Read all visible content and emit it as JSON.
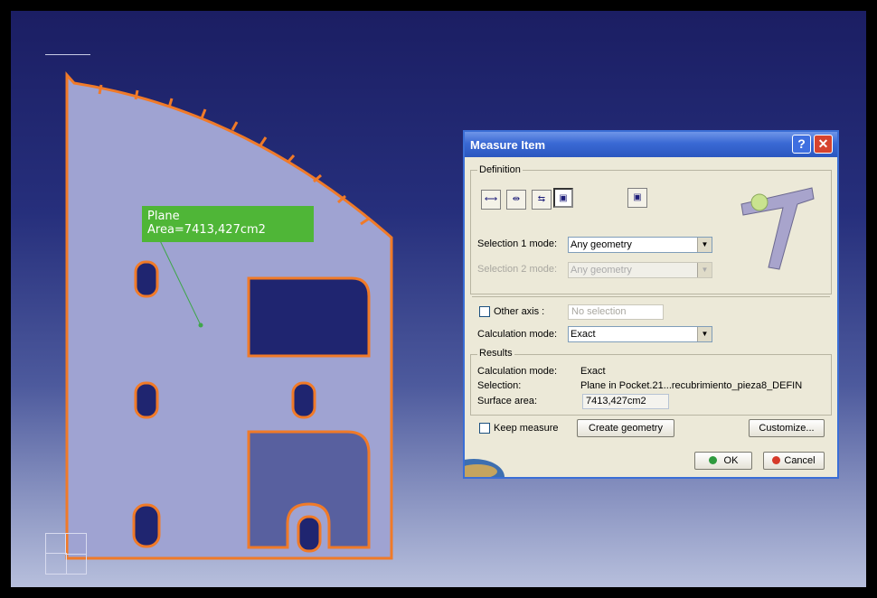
{
  "viewport": {
    "annotation": {
      "line1": "Plane",
      "line2": "Area=7413,427cm2"
    }
  },
  "dialog": {
    "title": "Measure Item",
    "title_buttons": {
      "help": "?",
      "close": "✕"
    },
    "definition": {
      "label": "Definition",
      "tools": [
        "measure-between",
        "measure-between-chain",
        "measure-between-fan",
        "measure-item-active",
        "measure-thickness"
      ],
      "selection1_label": "Selection 1 mode:",
      "selection1_value": "Any geometry",
      "selection2_label": "Selection 2 mode:",
      "selection2_value": "Any geometry",
      "other_axis_label": "Other axis :",
      "other_axis_placeholder": "No selection",
      "calc_mode_label": "Calculation mode:",
      "calc_mode_value": "Exact"
    },
    "results": {
      "label": "Results",
      "calc_mode_label": "Calculation mode:",
      "calc_mode_value": "Exact",
      "selection_label": "Selection:",
      "selection_value": "Plane in Pocket.21...recubrimiento_pieza8_DEFIN",
      "surface_area_label": "Surface area:",
      "surface_area_value": "7413,427cm2"
    },
    "keep_measure_label": "Keep measure",
    "create_geometry_label": "Create geometry",
    "customize_label": "Customize...",
    "ok_label": "OK",
    "cancel_label": "Cancel"
  },
  "colors": {
    "part_fill": "#9fa3d2",
    "part_edge": "#f07a28",
    "annotation_bg": "#4fb637",
    "titlebar": "#3a69d4"
  }
}
